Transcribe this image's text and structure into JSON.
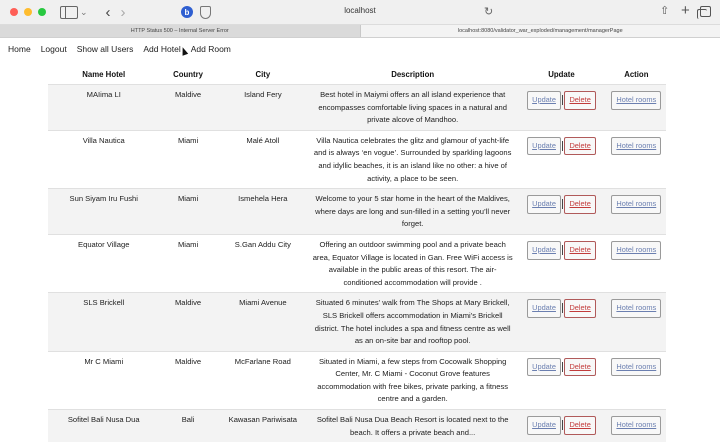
{
  "browser": {
    "url": "localhost",
    "tabs": [
      {
        "title": "HTTP Status 500 – Internal Server Error",
        "active": true
      },
      {
        "title": "localhost:8080/validator_war_exploded/management/managerPage",
        "active": false
      }
    ]
  },
  "nav": {
    "home": "Home",
    "logout": "Logout",
    "show_all_users": "Show all Users",
    "add_hotel": "Add Hotel",
    "add_room": "Add Room"
  },
  "table": {
    "headers": [
      "Name Hotel",
      "Country",
      "City",
      "Description",
      "Update",
      "Action"
    ],
    "buttons": {
      "update": "Update",
      "delete": "Delete",
      "rooms": "Hotel rooms"
    },
    "rows": [
      {
        "name": "MAIima LI",
        "country": "Maldive",
        "city": "Island Fery",
        "description": "Best hotel in Maiymi offers an all island experience that encompasses comfortable living spaces in a natural and private alcove of Mandhoo."
      },
      {
        "name": "Villa Nautica",
        "country": "Miami",
        "city": "Malé Atoll",
        "description": "Villa Nautica celebrates the glitz and glamour of yacht-life and is always ‘en vogue’. Surrounded by sparkling lagoons and idyllic beaches, it is an island like no other: a hive of activity, a place to be seen."
      },
      {
        "name": "Sun Siyam Iru Fushi",
        "country": "Miami",
        "city": "Ismehela Hera",
        "description": "Welcome to your 5 star home in the heart of the Maldives, where days are long and sun-filled in a setting you’ll never forget."
      },
      {
        "name": "Equator Village",
        "country": "Miami",
        "city": "S.Gan Addu City",
        "description": "Offering an outdoor swimming pool and a private beach area, Equator Village is located in Gan. Free WiFi access is available in the public areas of this resort. The air-conditioned accommodation will provide ."
      },
      {
        "name": "SLS Brickell",
        "country": "Maldive",
        "city": "Miami Avenue",
        "description": "Situated 6 minutes' walk from The Shops at Mary Brickell, SLS Brickell offers accommodation in Miami's Brickell district. The hotel includes a spa and fitness centre as well as an on-site bar and rooftop pool."
      },
      {
        "name": "Mr C Miami",
        "country": "Maldive",
        "city": "McFarlane Road",
        "description": "Situated in Miami, a few steps from Cocowalk Shopping Center, Mr. C Miami - Coconut Grove features accommodation with free bikes, private parking, a fitness centre and a garden."
      },
      {
        "name": "Sofitel Bali Nusa Dua",
        "country": "Bali",
        "city": "Kawasan Pariwisata",
        "description": "Sofitel Bali Nusa Dua Beach Resort is located next to the beach. It offers a private beach and..."
      }
    ]
  }
}
